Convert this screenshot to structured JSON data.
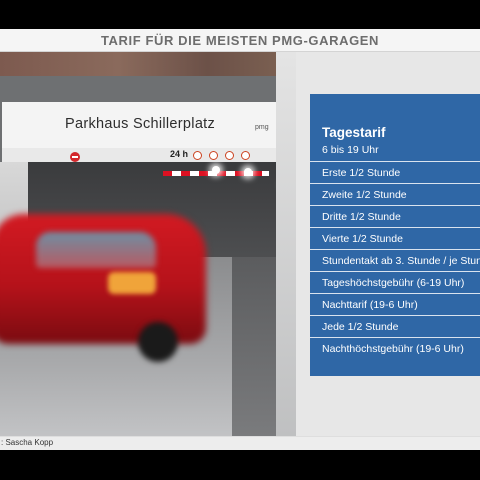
{
  "header": {
    "title": "TARIF FÜR DIE MEISTEN PMG-GARAGEN"
  },
  "photo": {
    "sign_text": "Parkhaus  Schillerplatz",
    "sign_logo": "pmg",
    "hours_label": "24 h",
    "credit": ": Sascha Kopp"
  },
  "tariff": {
    "title": "Tagestarif",
    "subtitle": "6 bis 19 Uhr",
    "rows": [
      "Erste 1/2 Stunde",
      "Zweite 1/2 Stunde",
      "Dritte 1/2 Stunde",
      "Vierte 1/2 Stunde",
      "Stundentakt ab 3. Stunde / je Stun",
      "Tageshöchstgebühr (6-19 Uhr)",
      "Nachttarif (19-6 Uhr)",
      "Jede 1/2 Stunde",
      "Nachthöchstgebühr (19-6 Uhr)"
    ]
  },
  "colors": {
    "panel": "#2f67a6",
    "header_text": "#6d6d6d",
    "car_red": "#c8151d"
  }
}
